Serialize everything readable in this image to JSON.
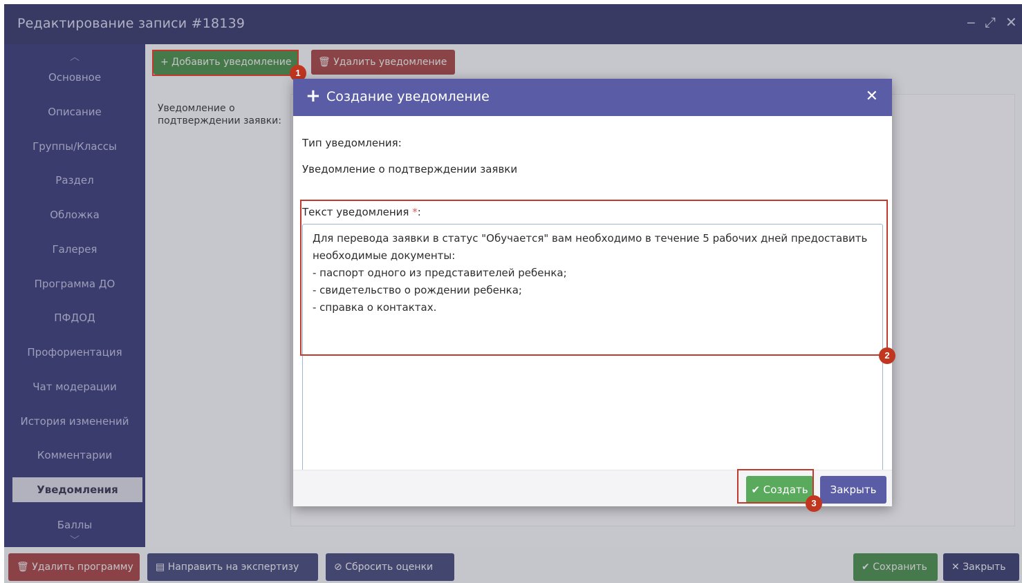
{
  "window": {
    "title": "Редактирование записи #18139",
    "controls": {
      "minimize": "‒",
      "maximize": "⤢",
      "close": "✕"
    }
  },
  "sidebar": {
    "items": [
      {
        "label": "Основное"
      },
      {
        "label": "Описание"
      },
      {
        "label": "Группы/Классы"
      },
      {
        "label": "Раздел"
      },
      {
        "label": "Обложка"
      },
      {
        "label": "Галерея"
      },
      {
        "label": "Программа ДО"
      },
      {
        "label": "ПФДОД"
      },
      {
        "label": "Профориентация"
      },
      {
        "label": "Чат модерации"
      },
      {
        "label": "История изменений"
      },
      {
        "label": "Комментарии"
      },
      {
        "label": "Уведомления",
        "active": true
      },
      {
        "label": "Баллы"
      }
    ]
  },
  "main": {
    "add_button": "+ Добавить уведомление",
    "delete_button": "Удалить уведомление",
    "notification_label": "Уведомление о подтверждении заявки:"
  },
  "bottombar": {
    "delete_program": "Удалить программу",
    "send_expertise": "Направить на экспертизу",
    "reset_scores": "Сбросить оценки",
    "save": "Сохранить",
    "close": "Закрыть"
  },
  "modal": {
    "title": "Создание уведомление",
    "type_label": "Тип уведомления:",
    "type_value": "Уведомление о подтверждении заявки",
    "text_label": "Текст уведомления",
    "required_mark": "*",
    "text_label_colon": ":",
    "text_lines": [
      "Для перевода заявки в статус \"Обучается\" вам необходимо в течение 5 рабочих дней предоставить",
      "необходимые документы:",
      "- паспорт одного из представителей ребенка;",
      "- свидетельство о рождении ребенка;",
      "- справка о контактах."
    ],
    "create_button": "Создать",
    "close_button": "Закрыть"
  },
  "markers": [
    "1",
    "2",
    "3"
  ],
  "colors": {
    "titlebar": "#3d3f6e",
    "sidebar": "#3f417a",
    "modal_header": "#5a5da6",
    "create_green": "#5aaa5e",
    "highlight_red": "#c0392b"
  }
}
